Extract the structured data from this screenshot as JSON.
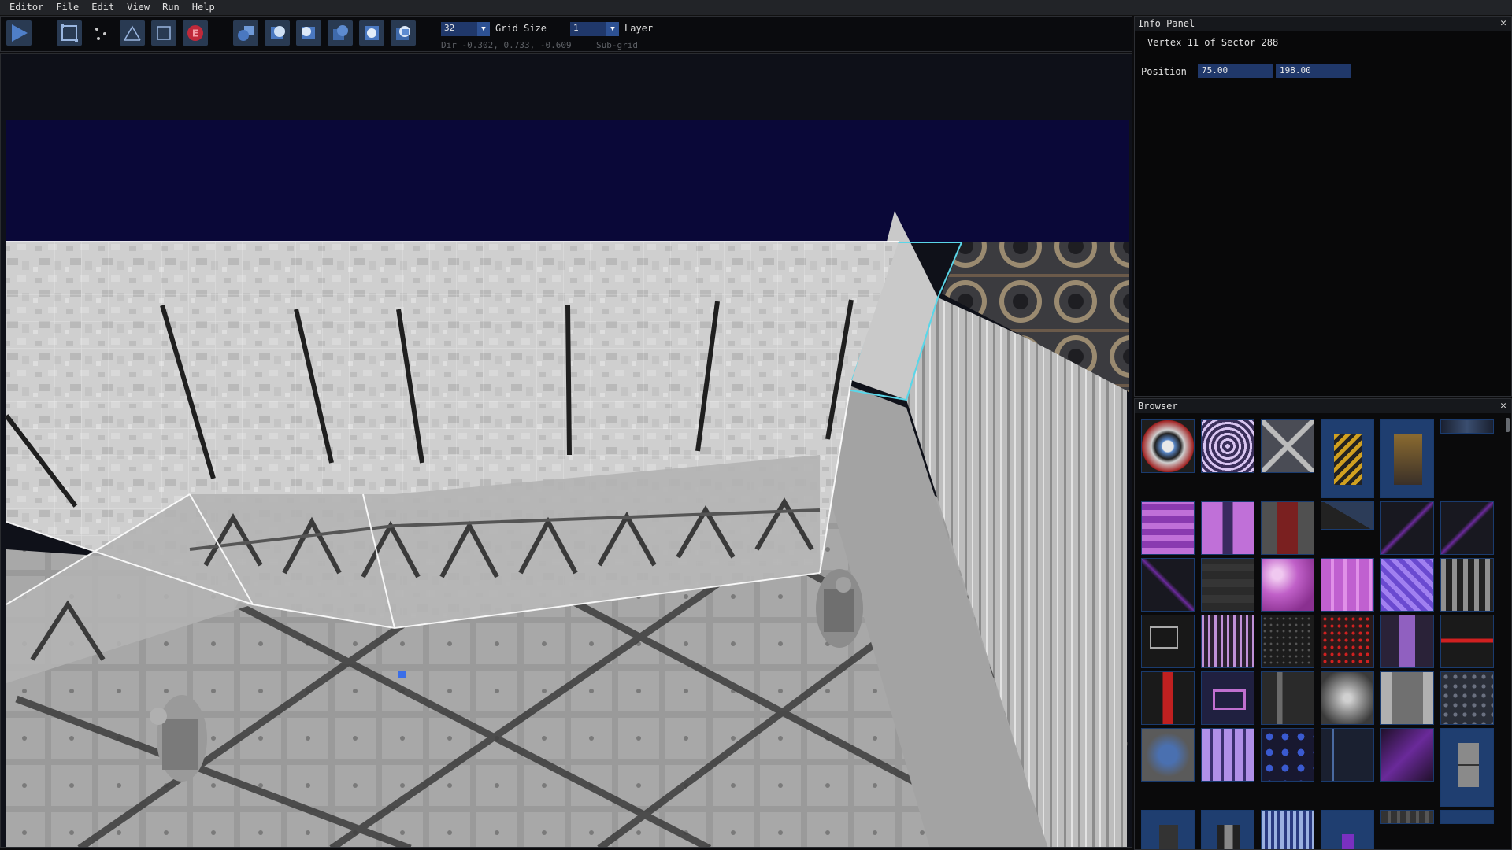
{
  "menu": {
    "items": [
      "Editor",
      "File",
      "Edit",
      "View",
      "Run",
      "Help"
    ]
  },
  "toolbar": {
    "grid_size": {
      "value": "32",
      "label": "Grid Size"
    },
    "layer": {
      "value": "1",
      "label": "Layer"
    },
    "direction_text": "Dir -0.302, 0.733, -0.609",
    "subgrid_label": "Sub-grid"
  },
  "info_panel": {
    "title": "Info Panel",
    "heading": "Vertex 11 of Sector 288",
    "position_label": "Position",
    "position_x": "75.00",
    "position_y": "198.00",
    "close_glyph": "✕"
  },
  "browser": {
    "title": "Browser",
    "close_glyph": "✕"
  },
  "colors": {
    "accent": "#2d5193",
    "field": "#20386a",
    "selection_cyan": "#5ad6e8",
    "sky": "#0a0838"
  }
}
